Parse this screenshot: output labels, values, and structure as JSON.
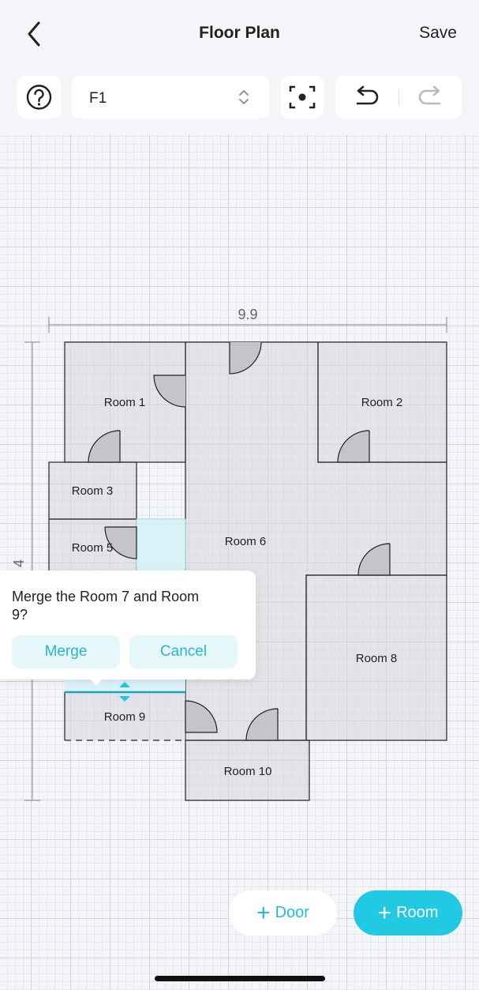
{
  "header": {
    "title": "Floor Plan",
    "save_label": "Save"
  },
  "toolbar": {
    "floor_value": "F1"
  },
  "plan": {
    "width_dimension": "9.9",
    "height_dimension": "4",
    "rooms": {
      "room1": "Room 1",
      "room2": "Room 2",
      "room3": "Room 3",
      "room5": "Room 5",
      "room6": "Room 6",
      "room8": "Room 8",
      "room9": "Room 9",
      "room10": "Room 10"
    }
  },
  "merge_popup": {
    "message": "Merge the Room 7 and Room 9?",
    "merge_label": "Merge",
    "cancel_label": "Cancel"
  },
  "actions": {
    "door_label": "Door",
    "room_label": "Room"
  },
  "colors": {
    "accent": "#22c9e3",
    "room_fill": "#d3d5d9",
    "selected_fill": "#d7f1f6"
  }
}
